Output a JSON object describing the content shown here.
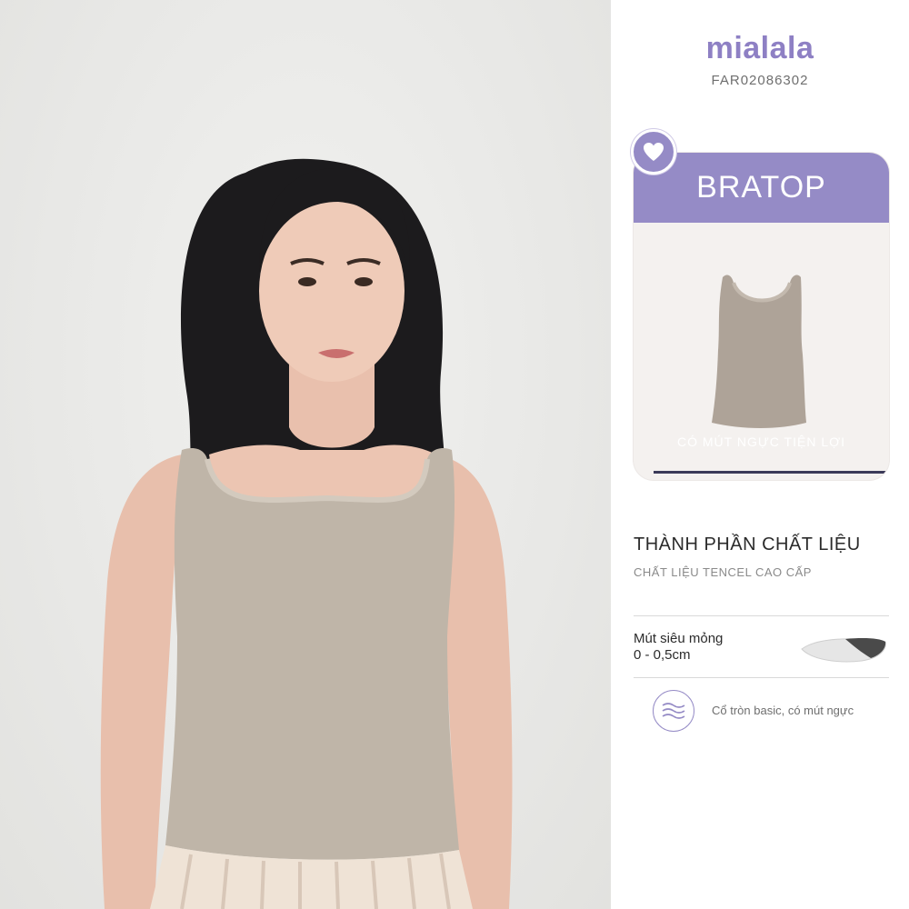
{
  "brand": {
    "name": "mialala",
    "sku": "FAR02086302",
    "accent_color": "#958bc6"
  },
  "feature_card": {
    "title": "BRATOP",
    "caption": "CÓ MÚT NGỰC TIỆN LỢI",
    "badge_icon": "heart-icon"
  },
  "material": {
    "title": "THÀNH PHẦN CHẤT LIỆU",
    "subtitle": "CHẤT LIỆU TENCEL CAO CẤP"
  },
  "foam": {
    "label": "Mút siêu mỏng",
    "thickness": "0 - 0,5cm",
    "icon": "foam-pad-icon"
  },
  "feature": {
    "icon": "fabric-wave-icon",
    "text": "Cổ tròn basic, có mút ngực"
  },
  "photo": {
    "icon": "model-photo",
    "garment_color": "#bfb5a8"
  }
}
